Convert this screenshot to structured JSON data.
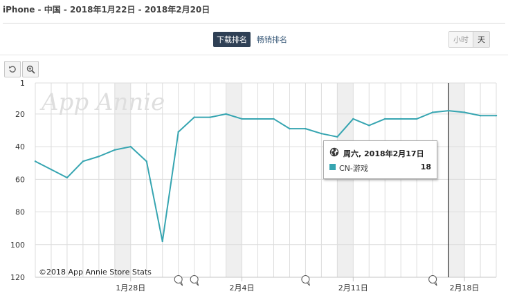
{
  "header": {
    "title": "iPhone - 中国 - 2018年1月22日 - 2018年2月20日"
  },
  "rank_tabs": [
    {
      "label": "下载排名",
      "active": true
    },
    {
      "label": "畅销排名",
      "active": false
    }
  ],
  "granularity": [
    {
      "label": "小时",
      "active": false
    },
    {
      "label": "天",
      "active": true
    }
  ],
  "toolbar": {
    "reset_icon": "undo-icon",
    "zoom_icon": "zoom-in-icon"
  },
  "watermark": "App Annie",
  "credit": "©2018 App Annie Store Stats",
  "tooltip": {
    "date": "周六, 2018年2月17日",
    "series": "CN-游戏",
    "value": "18",
    "icon": "globe-icon"
  },
  "colors": {
    "series": "#36a5b1",
    "weekend_band": "#efefef",
    "grid": "#dcdcdc",
    "crosshair": "#000000"
  },
  "chart_data": {
    "type": "line",
    "title": "",
    "xlabel": "",
    "ylabel": "",
    "y_reversed": true,
    "ylim": [
      1,
      120
    ],
    "y_ticks": [
      1,
      20,
      40,
      60,
      80,
      100,
      120
    ],
    "x_start": "2018-01-22",
    "x_end": "2018-02-20",
    "x_ticks": [
      {
        "date": "2018-01-28",
        "label": "1月28日"
      },
      {
        "date": "2018-02-04",
        "label": "2月4日"
      },
      {
        "date": "2018-02-11",
        "label": "2月11日"
      },
      {
        "date": "2018-02-18",
        "label": "2月18日"
      }
    ],
    "weekend_bands": [
      [
        "2018-01-27",
        "2018-01-28"
      ],
      [
        "2018-02-03",
        "2018-02-04"
      ],
      [
        "2018-02-10",
        "2018-02-11"
      ],
      [
        "2018-02-17",
        "2018-02-18"
      ]
    ],
    "grid": true,
    "legend": "none",
    "series": [
      {
        "name": "CN-游戏",
        "x": [
          "2018-01-22",
          "2018-01-23",
          "2018-01-24",
          "2018-01-25",
          "2018-01-26",
          "2018-01-27",
          "2018-01-28",
          "2018-01-29",
          "2018-01-30",
          "2018-01-31",
          "2018-02-01",
          "2018-02-02",
          "2018-02-03",
          "2018-02-04",
          "2018-02-05",
          "2018-02-06",
          "2018-02-07",
          "2018-02-08",
          "2018-02-09",
          "2018-02-10",
          "2018-02-11",
          "2018-02-12",
          "2018-02-13",
          "2018-02-14",
          "2018-02-15",
          "2018-02-16",
          "2018-02-17",
          "2018-02-18",
          "2018-02-19",
          "2018-02-20"
        ],
        "values": [
          49,
          54,
          59,
          49,
          46,
          42,
          40,
          49,
          98,
          31,
          22,
          22,
          20,
          23,
          23,
          23,
          29,
          29,
          32,
          34,
          23,
          27,
          23,
          23,
          23,
          19,
          18,
          19,
          21,
          21
        ]
      }
    ],
    "event_markers": [
      "2018-01-31",
      "2018-02-01",
      "2018-02-08",
      "2018-02-16"
    ],
    "crosshair_date": "2018-02-17"
  }
}
